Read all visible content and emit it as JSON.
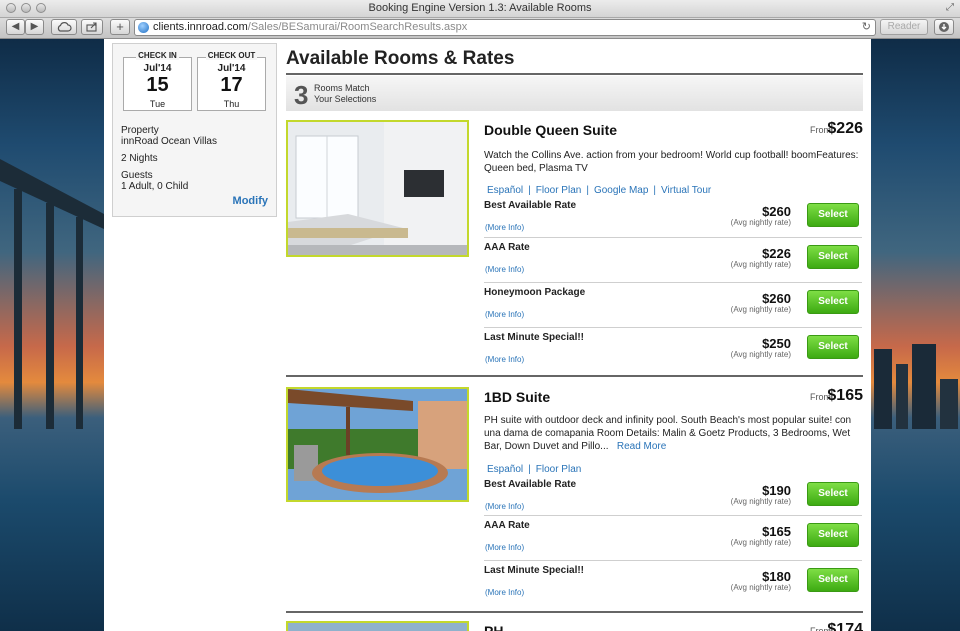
{
  "window": {
    "title": "Booking Engine Version 1.3: Available Rooms"
  },
  "browser": {
    "url_host": "clients.innroad.com",
    "url_path": "/Sales/BESamurai/RoomSearchResults.aspx",
    "reader_label": "Reader"
  },
  "stay": {
    "check_in": {
      "label": "CHECK IN",
      "month": "Jul'14",
      "day": "15",
      "dow": "Tue"
    },
    "check_out": {
      "label": "CHECK OUT",
      "month": "Jul'14",
      "day": "17",
      "dow": "Thu"
    },
    "property_label": "Property",
    "property_name": "innRoad Ocean Villas",
    "nights": "2 Nights",
    "guests_label": "Guests",
    "guests_value": "1 Adult, 0 Child",
    "modify_label": "Modify"
  },
  "main": {
    "heading": "Available Rooms & Rates",
    "match_count": "3",
    "match_line1": "Rooms Match",
    "match_line2": "Your Selections"
  },
  "labels": {
    "from": "From",
    "more_info": "(More Info)",
    "avg_nightly": "(Avg nightly rate)",
    "select": "Select",
    "read_more": "Read More"
  },
  "rooms": [
    {
      "name": "Double Queen Suite",
      "from_price": "$226",
      "description": "Watch the Collins Ave. action from your bedroom!  World cup football! boomFeatures: Queen bed, Plasma TV",
      "links": [
        "Español",
        "Floor Plan",
        "Google Map",
        "Virtual Tour"
      ],
      "rates": [
        {
          "name": "Best Available Rate",
          "price": "$260"
        },
        {
          "name": "AAA Rate",
          "price": "$226"
        },
        {
          "name": "Honeymoon Package",
          "price": "$260"
        },
        {
          "name": "Last Minute Special!!",
          "price": "$250"
        }
      ]
    },
    {
      "name": "1BD Suite",
      "from_price": "$165",
      "description": "PH suite with outdoor deck and infinity pool. South Beach's most popular suite! con una dama de comapania Room Details: Malin & Goetz Products, 3 Bedrooms, Wet Bar, Down Duvet and Pillo...",
      "links": [
        "Español",
        "Floor Plan"
      ],
      "rates": [
        {
          "name": "Best Available Rate",
          "price": "$190"
        },
        {
          "name": "AAA Rate",
          "price": "$165"
        },
        {
          "name": "Last Minute Special!!",
          "price": "$180"
        }
      ]
    },
    {
      "name": "PH",
      "from_price": "$174"
    }
  ]
}
